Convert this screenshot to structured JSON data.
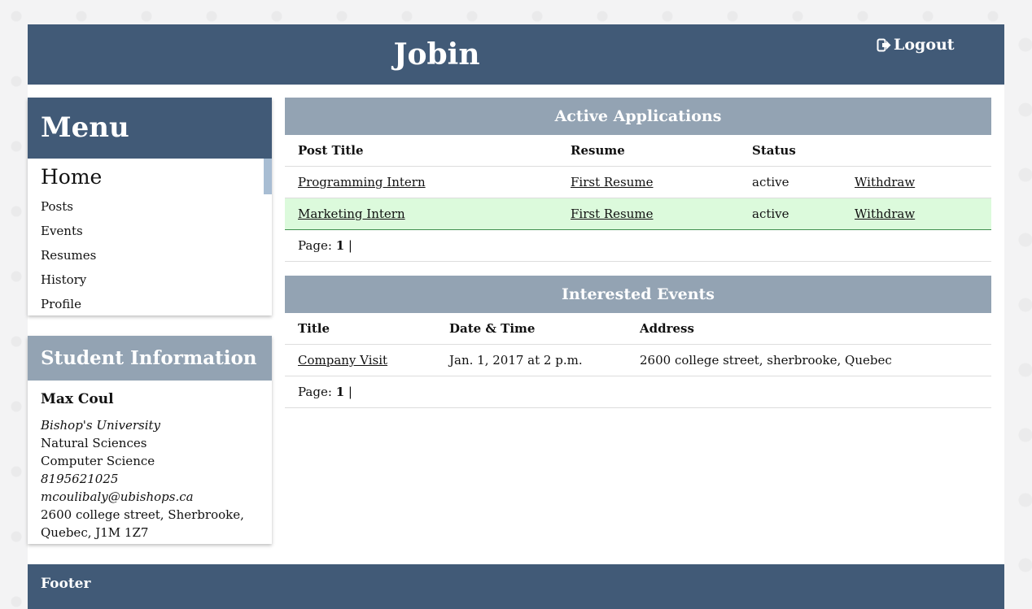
{
  "header": {
    "title": "Jobin",
    "logout_label": "Logout",
    "logout_icon": "logout-icon"
  },
  "menu": {
    "title": "Menu",
    "items": [
      {
        "label": "Home"
      },
      {
        "label": "Posts"
      },
      {
        "label": "Events"
      },
      {
        "label": "Resumes"
      },
      {
        "label": "History"
      },
      {
        "label": "Profile"
      }
    ]
  },
  "student": {
    "title": "Student Information",
    "name": "Max Coul",
    "university": "Bishop's University",
    "faculty": "Natural Sciences",
    "program": "Computer Science",
    "phone": "8195621025",
    "email": "mcoulibaly@ubishops.ca",
    "address_line1": "2600 college street, Sherbrooke,",
    "address_line2": "Quebec, J1M 1Z7"
  },
  "applications": {
    "title": "Active Applications",
    "columns": [
      "Post Title",
      "Resume",
      "Status"
    ],
    "rows": [
      {
        "post": "Programming Intern",
        "resume": "First Resume",
        "status": "active",
        "action": "Withdraw"
      },
      {
        "post": "Marketing Intern",
        "resume": "First Resume",
        "status": "active",
        "action": "Withdraw"
      }
    ],
    "pager_label": "Page:",
    "page": "1",
    "pager_sep": "|"
  },
  "events": {
    "title": "Interested Events",
    "columns": [
      "Title",
      "Date & Time",
      "Address"
    ],
    "rows": [
      {
        "title": "Company Visit",
        "datetime": "Jan. 1, 2017 at 2 p.m.",
        "address": "2600 college street, sherbrooke, Quebec"
      }
    ],
    "pager_label": "Page:",
    "page": "1",
    "pager_sep": "|"
  },
  "footer": {
    "label": "Footer"
  },
  "colors": {
    "primary": "#415a77",
    "secondary": "#93a3b3",
    "highlight_row": "#dcfadc"
  }
}
